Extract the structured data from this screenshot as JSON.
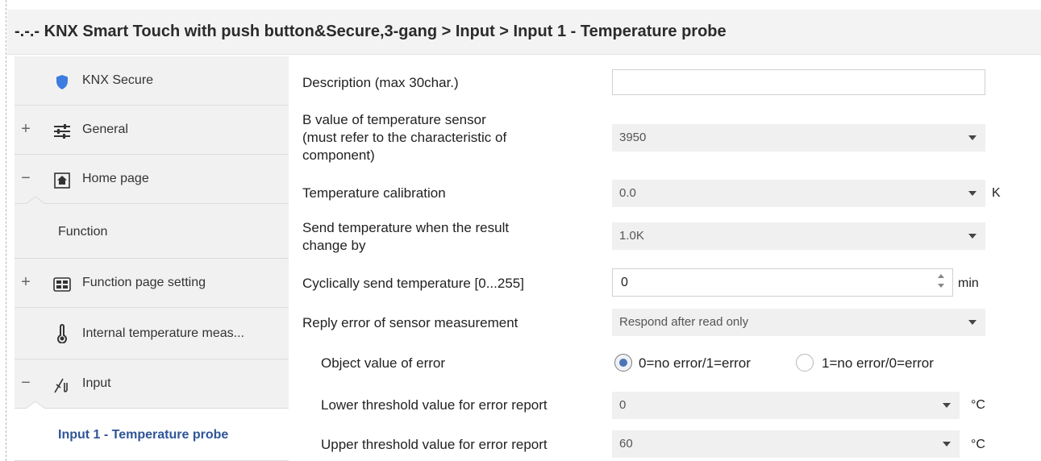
{
  "window": {
    "title": "-.-.- KNX Smart Touch with push button&Secure,3-gang > Input > Input 1 - Temperature probe"
  },
  "sidebar": {
    "items": [
      {
        "label": "KNX Secure",
        "sign": "",
        "icon": "shield-icon"
      },
      {
        "label": "General",
        "sign": "+",
        "icon": "sliders-icon"
      },
      {
        "label": "Home page",
        "sign": "−",
        "icon": "home-icon"
      },
      {
        "label": "Function",
        "sign": "",
        "icon": ""
      },
      {
        "label": "Function page setting",
        "sign": "+",
        "icon": "grid-icon"
      },
      {
        "label": "Internal temperature meas...",
        "sign": "",
        "icon": "thermometer-icon"
      },
      {
        "label": "Input",
        "sign": "−",
        "icon": "input-icon"
      },
      {
        "label": "Input 1 - Temperature probe",
        "sign": "",
        "icon": ""
      }
    ],
    "active_index": 7
  },
  "params": {
    "description": {
      "label": "Description (max 30char.)",
      "value": ""
    },
    "b_value": {
      "label_lines": [
        "B value of temperature sensor",
        "(must refer to the characteristic of",
        "component)"
      ],
      "value": "3950"
    },
    "calibration": {
      "label": "Temperature calibration",
      "value": "0.0",
      "unit": "K"
    },
    "send_change": {
      "label_lines": [
        "Send temperature when the result",
        "change by"
      ],
      "value": "1.0K"
    },
    "cyclic": {
      "label": "Cyclically send temperature [0...255]",
      "value": "0",
      "unit": "min"
    },
    "reply_error": {
      "label": "Reply error of  sensor measurement",
      "value": "Respond after read only"
    },
    "object_value": {
      "label": "Object value of error",
      "options": [
        "0=no error/1=error",
        "1=no error/0=error"
      ],
      "selected": 0
    },
    "lower_threshold": {
      "label": "Lower threshold value for error report",
      "value": "0",
      "unit": "°C"
    },
    "upper_threshold": {
      "label": "Upper threshold value for error report",
      "value": "60",
      "unit": "°C"
    }
  },
  "colors": {
    "accent": "#2f5597",
    "shield": "#3d7be0",
    "radio_dot": "#4a74b6"
  }
}
